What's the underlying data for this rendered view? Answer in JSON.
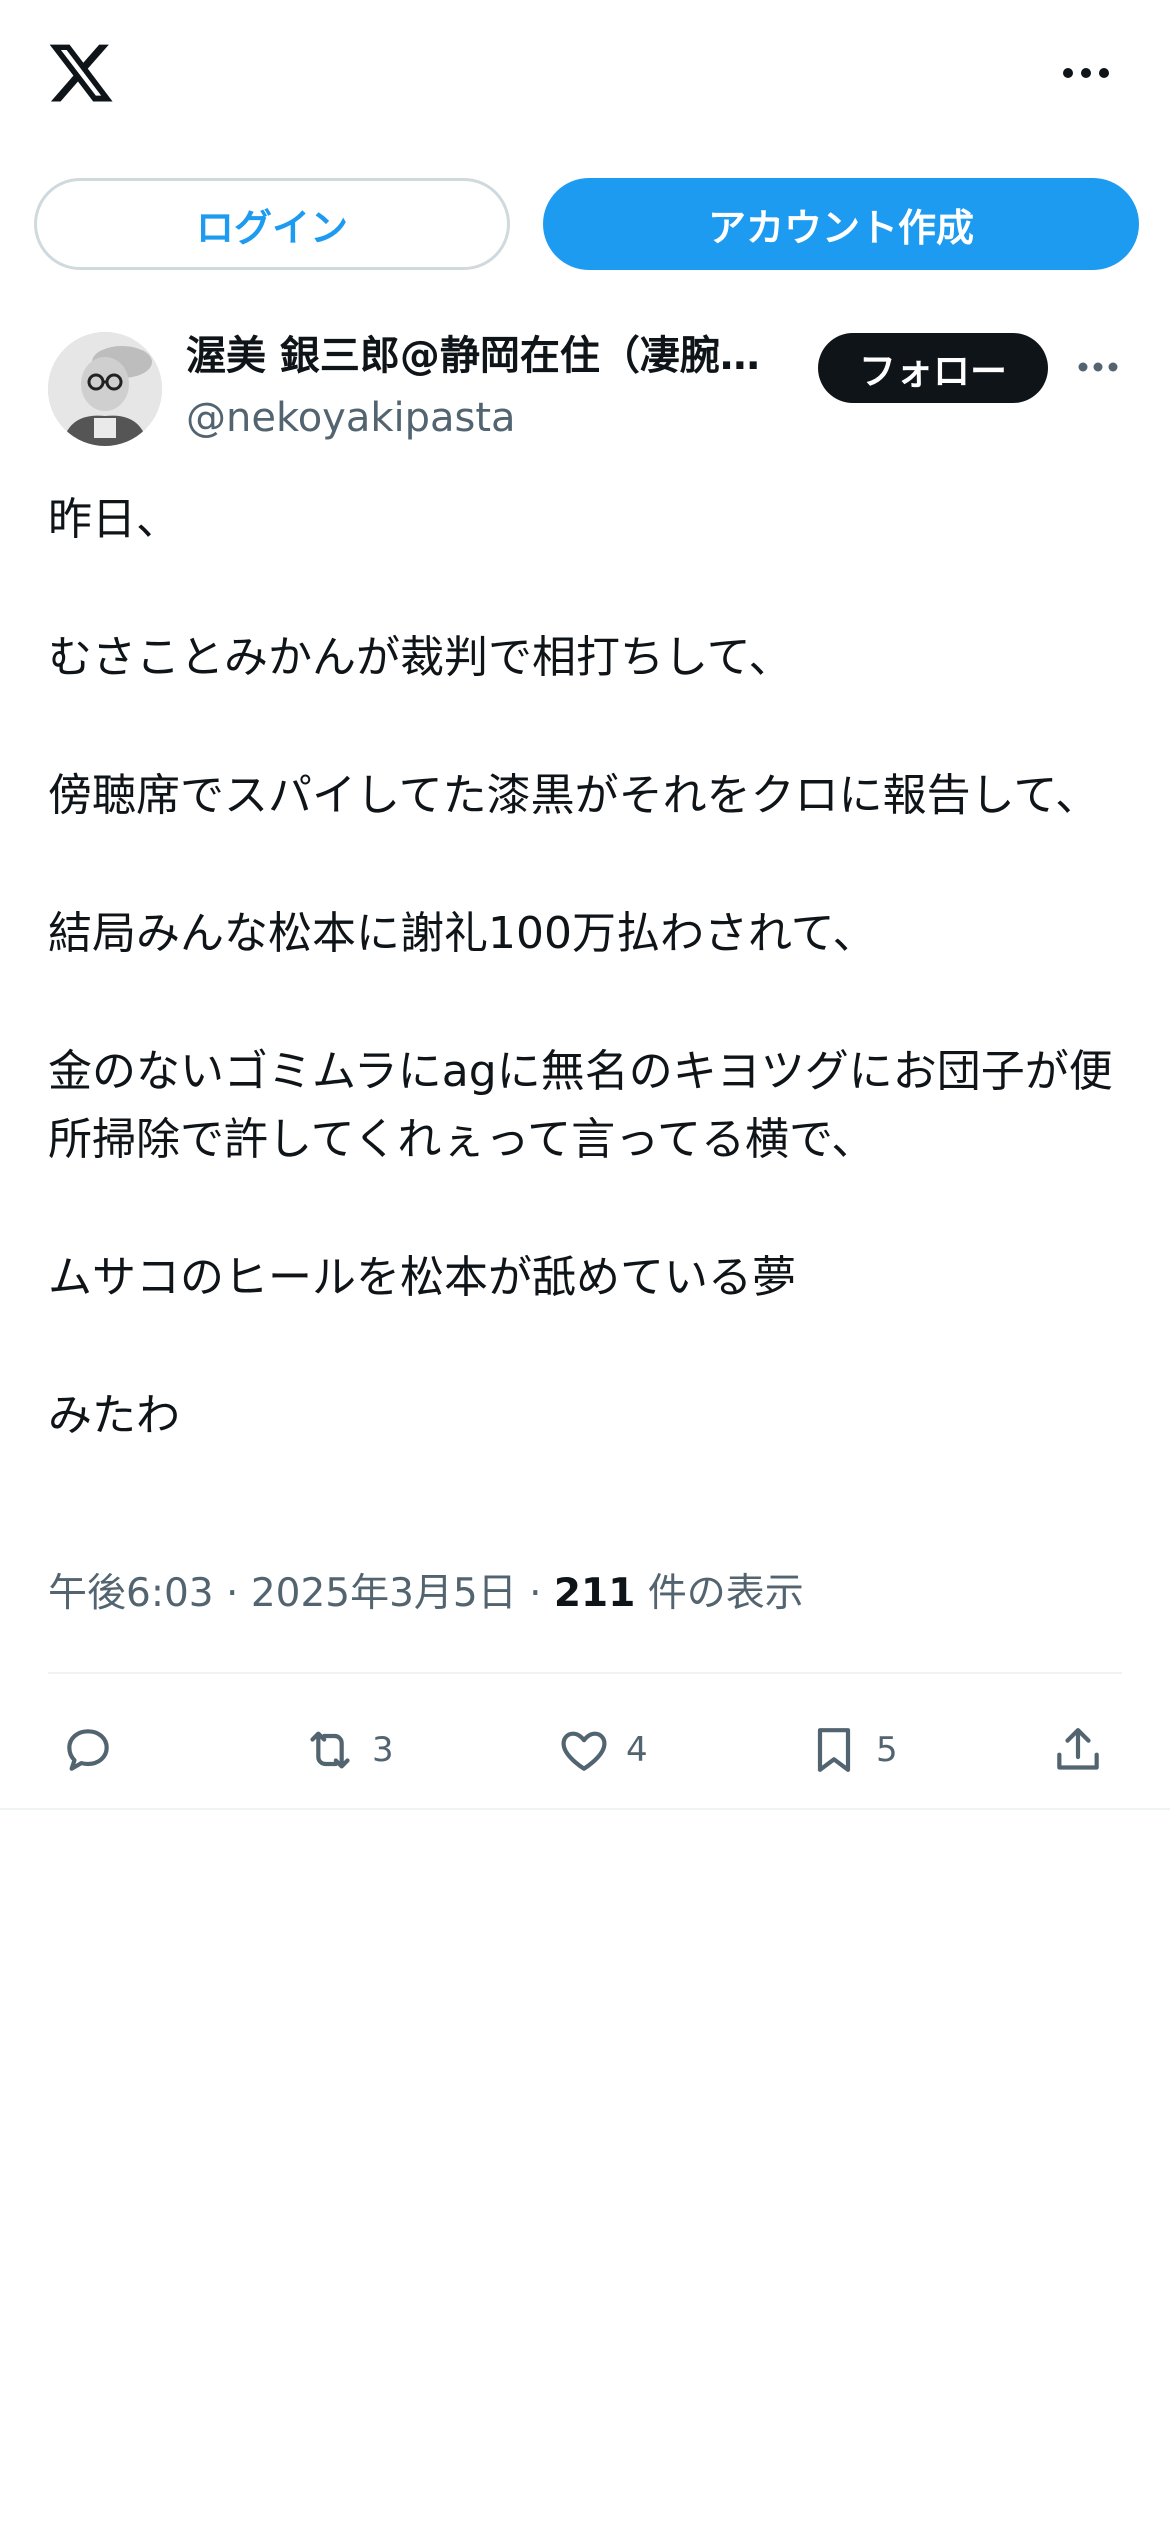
{
  "header": {
    "logo_icon": "x-logo-icon",
    "more_icon": "more-horizontal-icon"
  },
  "auth": {
    "login_label": "ログイン",
    "signup_label": "アカウント作成"
  },
  "post": {
    "author": {
      "display_name": "渥美 銀三郎@静岡在住（凄腕…",
      "handle": "@nekoyakipasta"
    },
    "follow_label": "フォロー",
    "paragraphs": [
      "昨日、",
      "むさことみかんが裁判で相打ちして、",
      "傍聴席でスパイしてた漆黒がそれをクロに報告して、",
      "結局みんな松本に謝礼100万払わされて、",
      "金のないゴミムラにagに無名のキヨツグにお団子が便所掃除で許してくれぇって言ってる横で、",
      "ムサコのヒールを松本が舐めている夢",
      "みたわ"
    ],
    "time": "午後6:03",
    "date": "2025年3月5日",
    "separator": "·",
    "views_count": "211",
    "views_label": "件の表示"
  },
  "actions": {
    "reply": {
      "icon": "reply-icon",
      "count": ""
    },
    "repost": {
      "icon": "repost-icon",
      "count": "3"
    },
    "like": {
      "icon": "heart-icon",
      "count": "4"
    },
    "bookmark": {
      "icon": "bookmark-icon",
      "count": "5"
    },
    "share": {
      "icon": "share-icon",
      "count": ""
    }
  },
  "colors": {
    "accent": "#1d9bf0",
    "text": "#0f1419",
    "secondary": "#536471",
    "border": "#cfd9de"
  }
}
